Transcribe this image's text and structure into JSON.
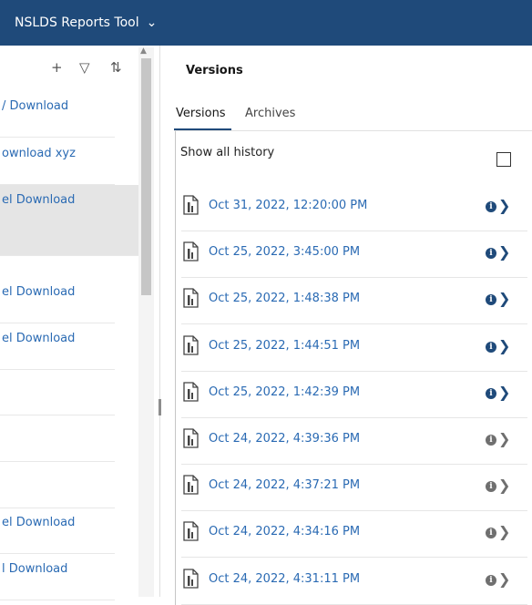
{
  "header": {
    "title": "NSLDS Reports Tool",
    "dropdown_icon": "chevron-down-icon"
  },
  "left_panel": {
    "toolbar": {
      "add_icon": "+",
      "filter_icon": "▽",
      "sort_icon": "⇅"
    },
    "items": [
      {
        "label": "/ Download"
      },
      {
        "label": "ownload xyz"
      },
      {
        "label": "el Download",
        "selected": true
      },
      {
        "label": "el Download"
      },
      {
        "label": "el Download"
      },
      {
        "label": ""
      },
      {
        "label": ""
      },
      {
        "label": ""
      },
      {
        "label": "el Download"
      },
      {
        "label": "l Download"
      }
    ]
  },
  "right_panel": {
    "title": "Versions",
    "tabs": [
      {
        "label": "Versions",
        "active": true
      },
      {
        "label": "Archives",
        "active": false
      }
    ],
    "show_all_history_label": "Show all history",
    "show_all_history_checked": false,
    "versions": [
      {
        "timestamp": "Oct 31, 2022, 12:20:00 PM",
        "enabled": true
      },
      {
        "timestamp": "Oct 25, 2022, 3:45:00 PM",
        "enabled": true
      },
      {
        "timestamp": "Oct 25, 2022, 1:48:38 PM",
        "enabled": true
      },
      {
        "timestamp": "Oct 25, 2022, 1:44:51 PM",
        "enabled": true
      },
      {
        "timestamp": "Oct 25, 2022, 1:42:39 PM",
        "enabled": true
      },
      {
        "timestamp": "Oct 24, 2022, 4:39:36 PM",
        "enabled": false
      },
      {
        "timestamp": "Oct 24, 2022, 4:37:21 PM",
        "enabled": false
      },
      {
        "timestamp": "Oct 24, 2022, 4:34:16 PM",
        "enabled": false
      },
      {
        "timestamp": "Oct 24, 2022, 4:31:11 PM",
        "enabled": false
      }
    ]
  },
  "colors": {
    "brand": "#1f4a7a",
    "link": "#2a6ab3",
    "icon_enabled": "#1f4a7a",
    "icon_disabled": "#6f6f6f"
  }
}
